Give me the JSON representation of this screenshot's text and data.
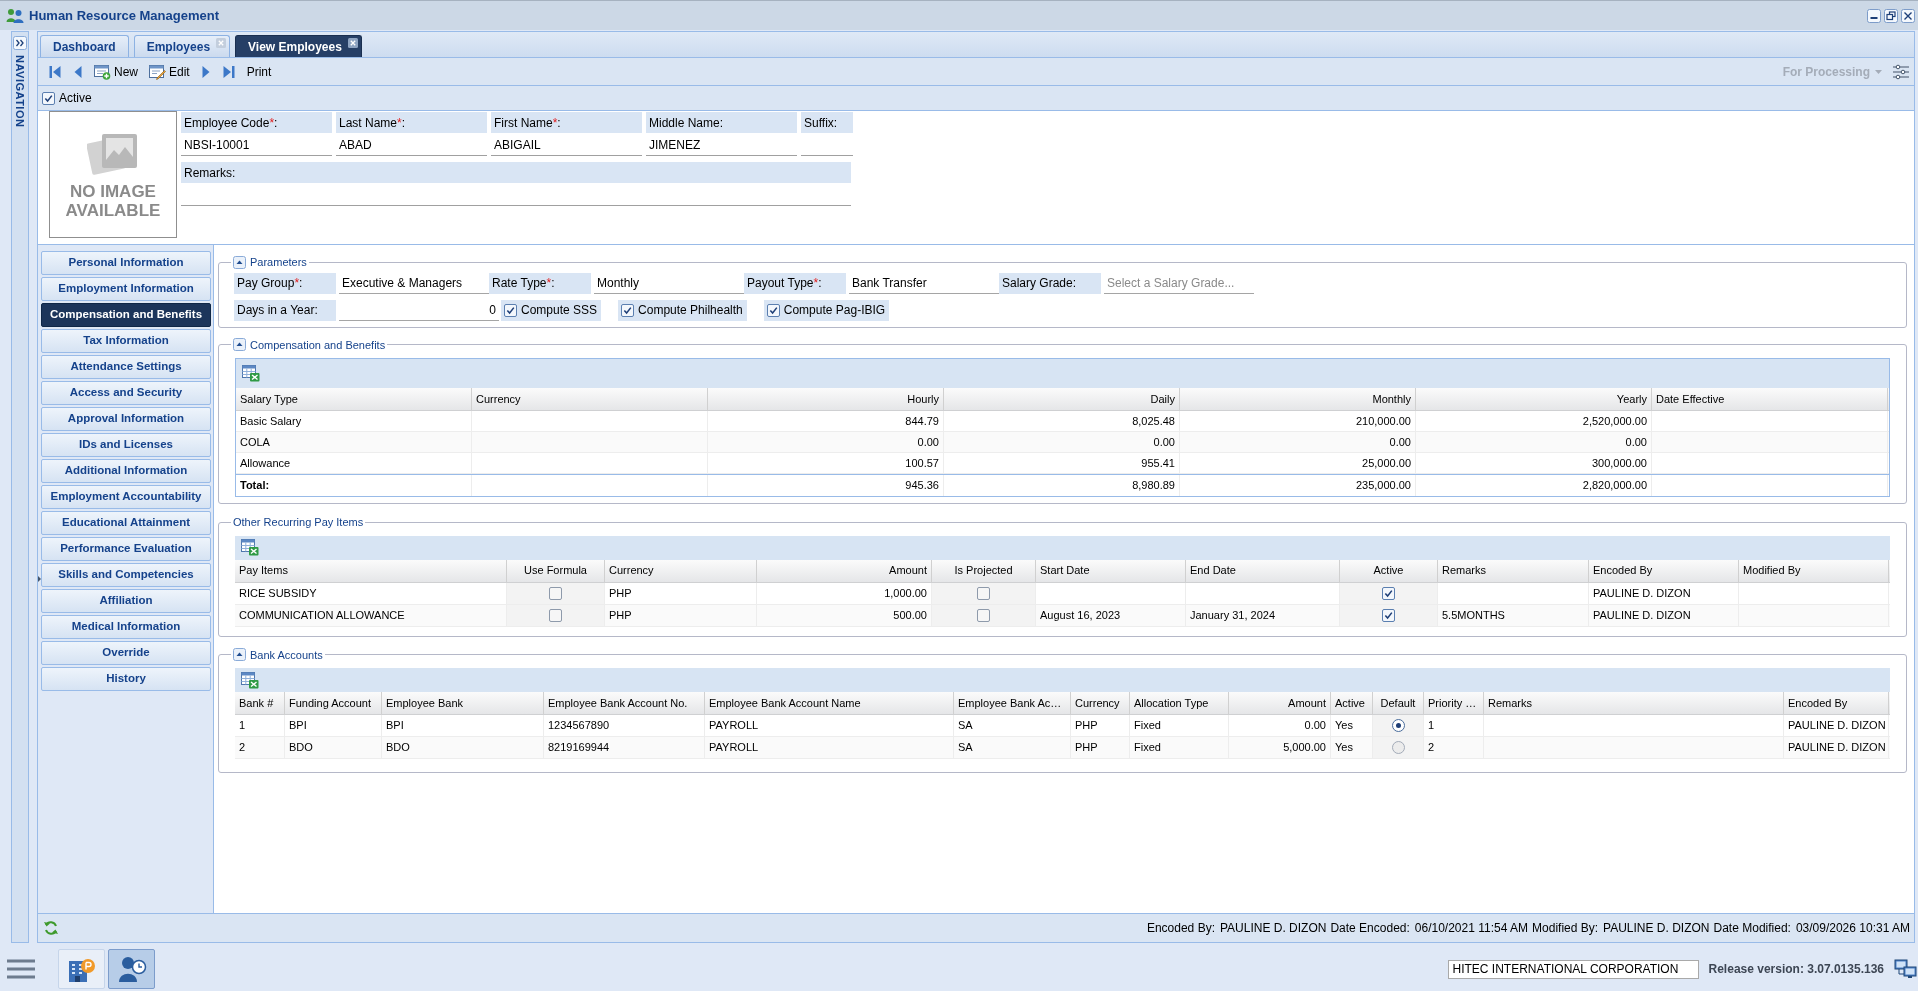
{
  "window": {
    "title": "Human Resource Management"
  },
  "navigation": {
    "label": "NAVIGATION"
  },
  "tabs": [
    {
      "label": "Dashboard",
      "selected": false,
      "closable": false
    },
    {
      "label": "Employees",
      "selected": false,
      "closable": true
    },
    {
      "label": "View Employees",
      "selected": true,
      "closable": true
    }
  ],
  "toolbar": {
    "buttons": [
      {
        "kind": "first"
      },
      {
        "kind": "previous"
      },
      {
        "kind": "new",
        "label": "New"
      },
      {
        "kind": "edit",
        "label": "Edit"
      },
      {
        "kind": "next"
      },
      {
        "kind": "last"
      },
      {
        "kind": "print",
        "label": "Print"
      }
    ],
    "status_filter": {
      "label": "For Processing",
      "disabled": true
    }
  },
  "active": {
    "label": "Active",
    "checked": true
  },
  "employee": {
    "photo_caption": "NO IMAGE AVAILABLE",
    "fields": [
      {
        "label": "Employee Code",
        "required_mark": "*",
        "suffix": ":",
        "value": "NBSI-10001"
      },
      {
        "label": "Last Name",
        "required_mark": "*",
        "suffix": ":",
        "value": "ABAD"
      },
      {
        "label": "First Name",
        "required_mark": "*",
        "suffix": ":",
        "value": "ABIGAIL"
      },
      {
        "label": "Middle Name",
        "suffix": ":",
        "value": "JIMENEZ"
      },
      {
        "label": "Suffix",
        "suffix": ":"
      }
    ],
    "remarks": {
      "label": "Remarks",
      "suffix": ":"
    }
  },
  "sidebar": {
    "items": [
      {
        "label": "Personal Information",
        "selected": false
      },
      {
        "label": "Employment Information",
        "selected": false
      },
      {
        "label": "Compensation and Benefits",
        "selected": true
      },
      {
        "label": "Tax Information",
        "selected": false
      },
      {
        "label": "Attendance Settings",
        "selected": false
      },
      {
        "label": "Access and Security",
        "selected": false
      },
      {
        "label": "Approval Information",
        "selected": false
      },
      {
        "label": "IDs and Licenses",
        "selected": false
      },
      {
        "label": "Additional Information",
        "selected": false
      },
      {
        "label": "Employment Accountability",
        "selected": false
      },
      {
        "label": "Educational Attainment",
        "selected": false
      },
      {
        "label": "Performance Evaluation",
        "selected": false
      },
      {
        "label": "Skills and Competencies",
        "selected": false
      },
      {
        "label": "Affiliation",
        "selected": false
      },
      {
        "label": "Medical Information",
        "selected": false
      },
      {
        "label": "Override",
        "selected": false
      },
      {
        "label": "History",
        "selected": false
      }
    ]
  },
  "parameters": {
    "title": "Parameters",
    "collapsible": true,
    "fields": [
      {
        "label": "Pay Group",
        "required_mark": "*",
        "suffix": ":",
        "value": "Executive & Managers"
      },
      {
        "label": "Rate Type",
        "required_mark": "*",
        "suffix": ":",
        "value": "Monthly"
      },
      {
        "label": "Payout Type",
        "required_mark": "*",
        "suffix": ":",
        "value": "Bank Transfer"
      },
      {
        "label": "Salary Grade",
        "suffix": ":",
        "placeholder": "Select a Salary Grade..."
      }
    ],
    "days_in_year": {
      "label": "Days in a Year",
      "suffix": ":",
      "value": "0"
    },
    "checkboxes": [
      {
        "label": "Compute SSS",
        "checked": true
      },
      {
        "label": "Compute Philhealth",
        "checked": true
      },
      {
        "label": "Compute Pag-IBIG",
        "checked": true
      }
    ]
  },
  "compensation": {
    "title": "Compensation and Benefits",
    "collapsible": true,
    "columns": [
      "Salary Type",
      "Currency",
      "Hourly",
      "Daily",
      "Monthly",
      "Yearly",
      "Date Effective"
    ],
    "rows": [
      {
        "salary_type": "Basic Salary",
        "hourly": "844.79",
        "daily": "8,025.48",
        "monthly": "210,000.00",
        "yearly": "2,520,000.00"
      },
      {
        "salary_type": "COLA",
        "hourly": "0.00",
        "daily": "0.00",
        "monthly": "0.00",
        "yearly": "0.00"
      },
      {
        "salary_type": "Allowance",
        "hourly": "100.57",
        "daily": "955.41",
        "monthly": "25,000.00",
        "yearly": "300,000.00"
      }
    ],
    "total": {
      "salary_type": "Total:",
      "hourly": "945.36",
      "daily": "8,980.89",
      "monthly": "235,000.00",
      "yearly": "2,820,000.00"
    }
  },
  "other_pay_items": {
    "title": "Other Recurring Pay Items",
    "collapsible": false,
    "columns": [
      "Pay Items",
      "Use Formula",
      "Currency",
      "Amount",
      "Is Projected",
      "Start Date",
      "End Date",
      "Active",
      "Remarks",
      "Encoded By",
      "Modified By"
    ],
    "rows": [
      {
        "pay_item": "RICE SUBSIDY",
        "use_formula": false,
        "currency": "PHP",
        "amount": "1,000.00",
        "is_projected": false,
        "active": true,
        "encoded_by": "PAULINE D. DIZON"
      },
      {
        "pay_item": "COMMUNICATION ALLOWANCE",
        "use_formula": false,
        "currency": "PHP",
        "amount": "500.00",
        "is_projected": false,
        "start_date": "August 16, 2023",
        "end_date": "January 31, 2024",
        "active": true,
        "remarks": "5.5MONTHS",
        "encoded_by": "PAULINE D. DIZON"
      }
    ]
  },
  "bank_accounts": {
    "title": "Bank Accounts",
    "collapsible": true,
    "columns": [
      "Bank #",
      "Funding Account",
      "Employee Bank",
      "Employee Bank Account No.",
      "Employee Bank Account Name",
      "Employee Bank Ac…",
      "Currency",
      "Allocation Type",
      "Amount",
      "Active",
      "Default",
      "Priority …",
      "Remarks",
      "Encoded By"
    ],
    "rows": [
      {
        "bank_no": "1",
        "funding_account": "BPI",
        "employee_bank": "BPI",
        "account_no": "1234567890",
        "account_name": "PAYROLL",
        "account_type": "SA",
        "currency": "PHP",
        "allocation_type": "Fixed",
        "amount": "0.00",
        "active": "Yes",
        "default": true,
        "priority": "1",
        "encoded_by": "PAULINE D. DIZON"
      },
      {
        "bank_no": "2",
        "funding_account": "BDO",
        "employee_bank": "BDO",
        "account_no": "8219169944",
        "account_name": "PAYROLL",
        "account_type": "SA",
        "currency": "PHP",
        "allocation_type": "Fixed",
        "amount": "5,000.00",
        "active": "Yes",
        "default": false,
        "priority": "2",
        "encoded_by": "PAULINE D. DIZON"
      }
    ]
  },
  "status_bar": {
    "items": [
      {
        "label": "Encoded By:",
        "value": "PAULINE D. DIZON"
      },
      {
        "label": "Date Encoded:",
        "value": "06/10/2021 11:54 AM"
      },
      {
        "label": "Modified By:",
        "value": "PAULINE D. DIZON"
      },
      {
        "label": "Date Modified:",
        "value": "03/09/2026 10:31 AM"
      }
    ]
  },
  "taskbar": {
    "apps": [
      {
        "kind": "payroll",
        "selected": false
      },
      {
        "kind": "employee",
        "selected": true
      }
    ],
    "company": {
      "value": "HITEC INTERNATIONAL CORPORATION"
    },
    "release": "Release version: 3.07.0135.136"
  }
}
